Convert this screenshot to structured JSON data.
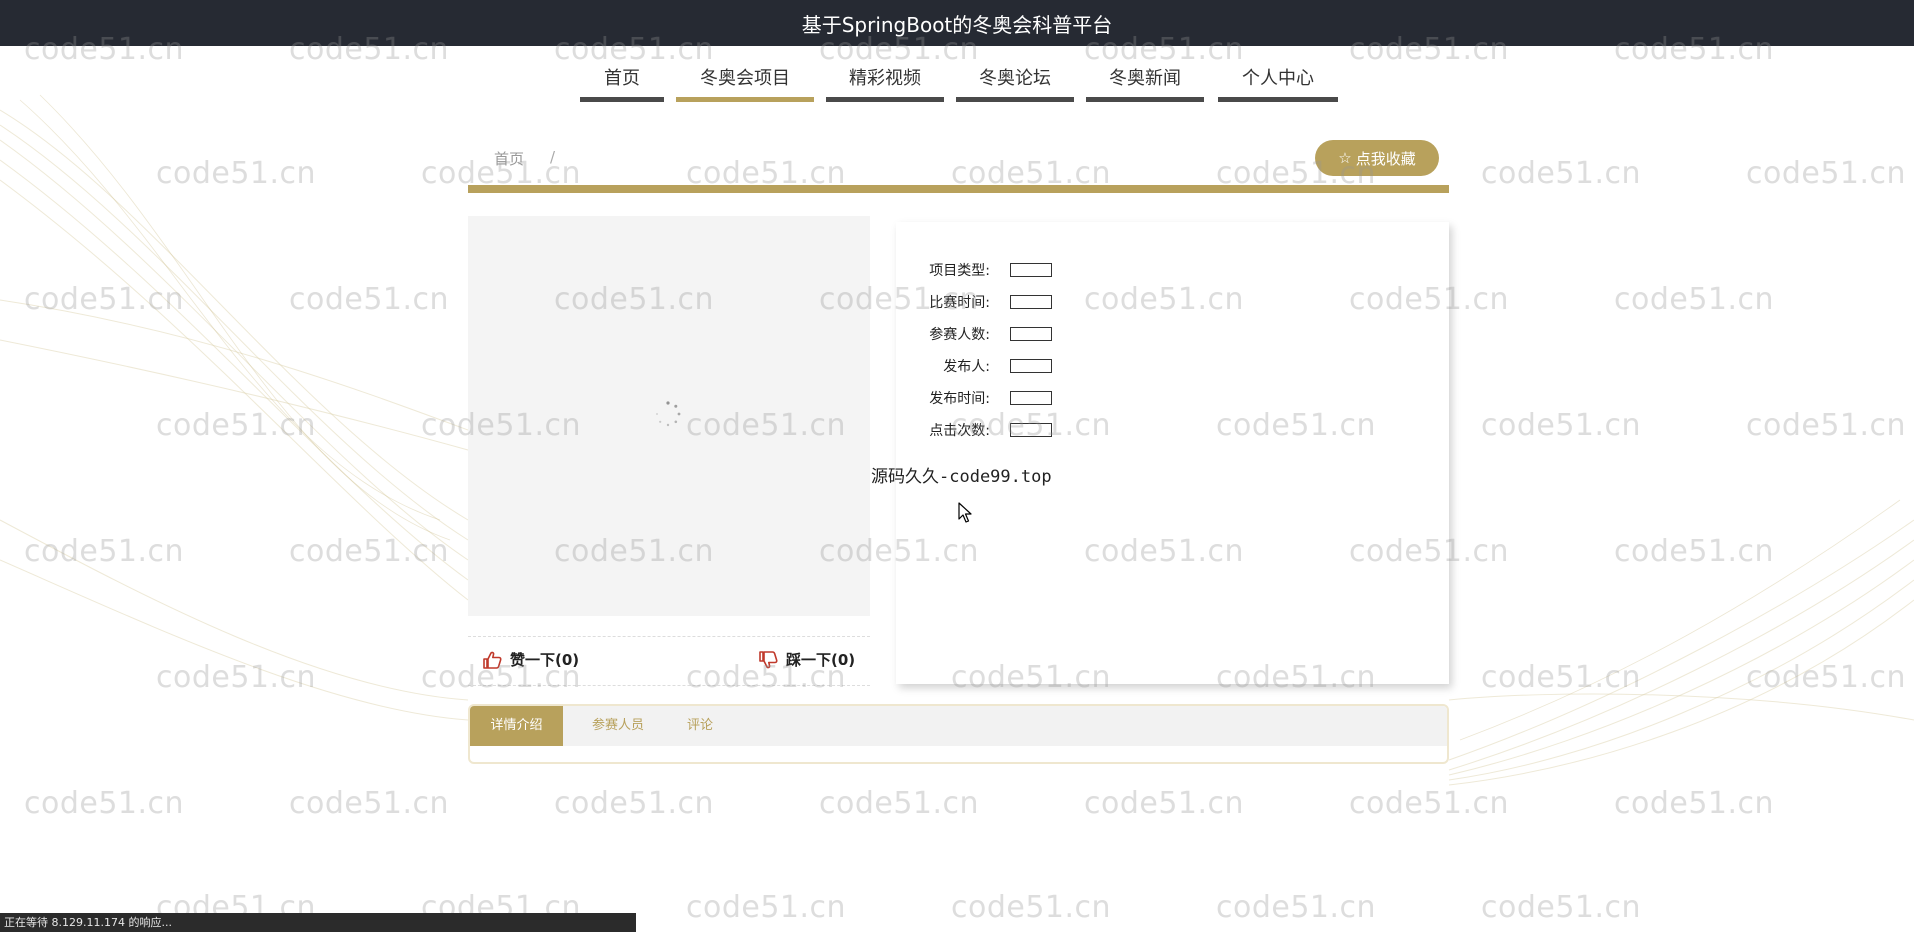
{
  "window": {
    "title": "基于SpringBoot的冬奥会科普平台"
  },
  "nav": {
    "items": [
      {
        "label": "首页"
      },
      {
        "label": "冬奥会项目"
      },
      {
        "label": "精彩视频"
      },
      {
        "label": "冬奥论坛"
      },
      {
        "label": "冬奥新闻"
      },
      {
        "label": "个人中心"
      }
    ],
    "active_index": 1
  },
  "breadcrumb": {
    "home": "首页",
    "separator": "/"
  },
  "favorite_button": {
    "icon": "star-outline-icon",
    "label": "点我收藏"
  },
  "details": {
    "rows": [
      {
        "label": "项目类型:",
        "value": ""
      },
      {
        "label": "比赛时间:",
        "value": ""
      },
      {
        "label": "参赛人数:",
        "value": ""
      },
      {
        "label": "发布人:",
        "value": ""
      },
      {
        "label": "发布时间:",
        "value": ""
      },
      {
        "label": "点击次数:",
        "value": ""
      }
    ]
  },
  "source_text": "源码久久-code99.top",
  "votes": {
    "like": {
      "icon": "thumbs-up-icon",
      "label": "赞一下(0)"
    },
    "dislike": {
      "icon": "thumbs-down-icon",
      "label": "踩一下(0)"
    }
  },
  "tabs": [
    {
      "label": "详情介绍",
      "active": true
    },
    {
      "label": "参赛人员",
      "active": false
    },
    {
      "label": "评论",
      "active": false
    }
  ],
  "watermark": "code51.cn",
  "status_bar": {
    "text": "正在等待 8.129.11.174 的响应..."
  },
  "colors": {
    "accent": "#b8a15c",
    "topbar": "#262a33",
    "nav_bar": "#4a4a4a"
  }
}
